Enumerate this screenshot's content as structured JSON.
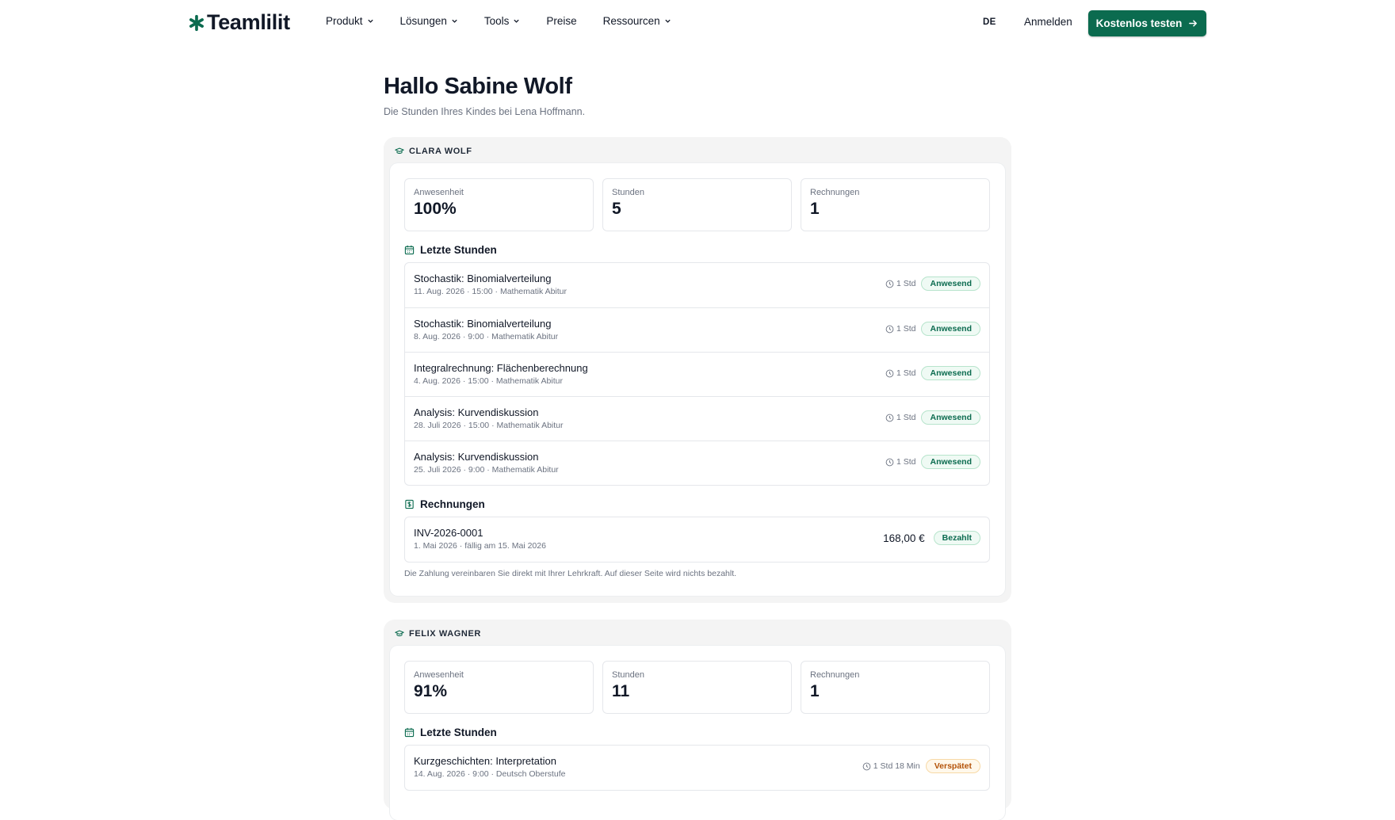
{
  "header": {
    "logo_text": "Teamlilit",
    "nav": [
      {
        "label": "Produkt",
        "dropdown": true
      },
      {
        "label": "Lösungen",
        "dropdown": true
      },
      {
        "label": "Tools",
        "dropdown": true
      },
      {
        "label": "Preise",
        "dropdown": false
      },
      {
        "label": "Ressourcen",
        "dropdown": true
      }
    ],
    "language": "DE",
    "login_label": "Anmelden",
    "cta_label": "Kostenlos testen"
  },
  "page": {
    "greeting": "Hallo Sabine Wolf",
    "subtitle": "Die Stunden Ihres Kindes bei Lena Hoffmann."
  },
  "children": [
    {
      "name": "CLARA WOLF",
      "stats": [
        {
          "label": "Anwesenheit",
          "value": "100%"
        },
        {
          "label": "Stunden",
          "value": "5"
        },
        {
          "label": "Rechnungen",
          "value": "1"
        }
      ],
      "lessons_title": "Letzte Stunden",
      "lessons": [
        {
          "title": "Stochastik: Binomialverteilung",
          "meta": "11. Aug. 2026 · 15:00 · Mathematik Abitur",
          "duration": "1 Std",
          "status": "Anwesend",
          "status_type": "green"
        },
        {
          "title": "Stochastik: Binomialverteilung",
          "meta": "8. Aug. 2026 · 9:00 · Mathematik Abitur",
          "duration": "1 Std",
          "status": "Anwesend",
          "status_type": "green"
        },
        {
          "title": "Integralrechnung: Flächenberechnung",
          "meta": "4. Aug. 2026 · 15:00 · Mathematik Abitur",
          "duration": "1 Std",
          "status": "Anwesend",
          "status_type": "green"
        },
        {
          "title": "Analysis: Kurvendiskussion",
          "meta": "28. Juli 2026 · 15:00 · Mathematik Abitur",
          "duration": "1 Std",
          "status": "Anwesend",
          "status_type": "green"
        },
        {
          "title": "Analysis: Kurvendiskussion",
          "meta": "25. Juli 2026 · 9:00 · Mathematik Abitur",
          "duration": "1 Std",
          "status": "Anwesend",
          "status_type": "green"
        }
      ],
      "invoices_title": "Rechnungen",
      "invoices": [
        {
          "number": "INV-2026-0001",
          "meta": "1. Mai 2026 · fällig am 15. Mai 2026",
          "amount": "168,00 €",
          "status": "Bezahlt",
          "status_type": "green"
        }
      ],
      "note": "Die Zahlung vereinbaren Sie direkt mit Ihrer Lehrkraft. Auf dieser Seite wird nichts bezahlt."
    },
    {
      "name": "FELIX WAGNER",
      "stats": [
        {
          "label": "Anwesenheit",
          "value": "91%"
        },
        {
          "label": "Stunden",
          "value": "11"
        },
        {
          "label": "Rechnungen",
          "value": "1"
        }
      ],
      "lessons_title": "Letzte Stunden",
      "lessons": [
        {
          "title": "Kurzgeschichten: Interpretation",
          "meta": "14. Aug. 2026 · 9:00 · Deutsch Oberstufe",
          "duration": "1 Std 18 Min",
          "status": "Verspätet",
          "status_type": "amber"
        }
      ]
    }
  ],
  "colors": {
    "brand": "#0b6b4f",
    "status_present": "#0b6b4f",
    "status_late": "#b45309"
  }
}
